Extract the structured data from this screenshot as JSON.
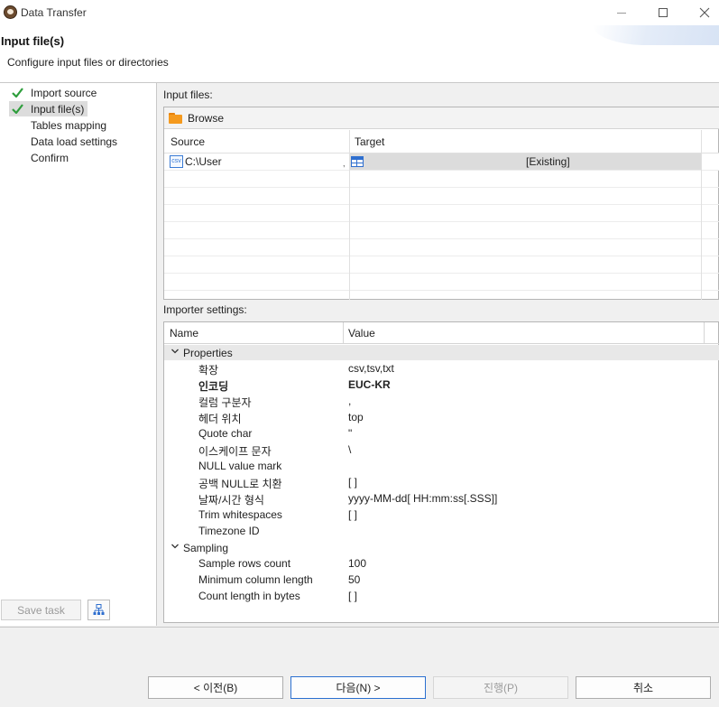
{
  "window": {
    "title": "Data Transfer"
  },
  "header": {
    "title": "Input file(s)",
    "subtitle": "Configure input files or directories"
  },
  "nav": {
    "items": [
      {
        "label": "Import source",
        "checked": true,
        "selected": false
      },
      {
        "label": "Input file(s)",
        "checked": true,
        "selected": true
      },
      {
        "label": "Tables mapping",
        "checked": false,
        "selected": false
      },
      {
        "label": "Data load settings",
        "checked": false,
        "selected": false
      },
      {
        "label": "Confirm",
        "checked": false,
        "selected": false
      }
    ],
    "save_task_label": "Save task"
  },
  "input_files": {
    "section_label": "Input files:",
    "browse_label": "Browse",
    "columns": {
      "source": "Source",
      "target": "Target"
    },
    "rows": [
      {
        "source": "C:\\User",
        "target_status": "[Existing]"
      }
    ]
  },
  "importer": {
    "section_label": "Importer settings:",
    "columns": {
      "name": "Name",
      "value": "Value"
    },
    "groups": [
      {
        "label": "Properties",
        "props": [
          {
            "name": "확장",
            "value": "csv,tsv,txt",
            "bold": false
          },
          {
            "name": "인코딩",
            "value": "EUC-KR",
            "bold": true
          },
          {
            "name": "컬럼 구분자",
            "value": ",",
            "bold": false
          },
          {
            "name": "헤더 위치",
            "value": "top",
            "bold": false
          },
          {
            "name": "Quote char",
            "value": "\"",
            "bold": false
          },
          {
            "name": "이스케이프 문자",
            "value": "\\",
            "bold": false
          },
          {
            "name": "NULL value mark",
            "value": "",
            "bold": false
          },
          {
            "name": "공백 NULL로 치환",
            "value": "[ ]",
            "bold": false
          },
          {
            "name": "날짜/시간 형식",
            "value": "yyyy-MM-dd[ HH:mm:ss[.SSS]]",
            "bold": false
          },
          {
            "name": "Trim whitespaces",
            "value": "[ ]",
            "bold": false
          },
          {
            "name": "Timezone ID",
            "value": "",
            "bold": false
          }
        ]
      },
      {
        "label": "Sampling",
        "props": [
          {
            "name": "Sample rows count",
            "value": "100",
            "bold": false
          },
          {
            "name": "Minimum column length",
            "value": "50",
            "bold": false
          },
          {
            "name": "Count length in bytes",
            "value": "[ ]",
            "bold": false
          }
        ]
      }
    ]
  },
  "footer": {
    "back": "< 이전(B)",
    "next": "다음(N) >",
    "proceed": "진행(P)",
    "cancel": "취소"
  },
  "colors": {
    "accent": "#2a6fd0",
    "check": "#2e9e3c",
    "folder": "#f59a1e"
  }
}
